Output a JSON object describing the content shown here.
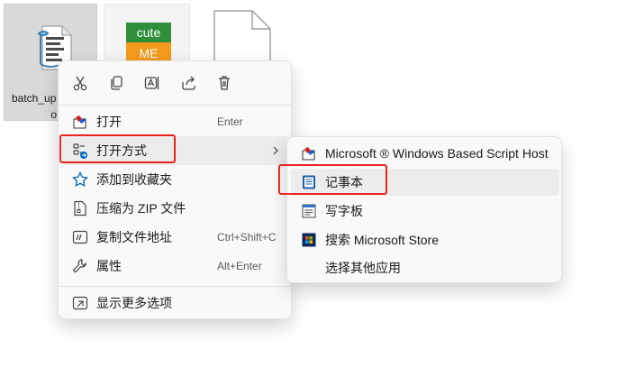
{
  "files": {
    "selected_file": {
      "name_line1": "batch_up",
      "name_line2": "o",
      "icon": "script-file-icon"
    },
    "second_file": {
      "icon_top": "cute",
      "icon_bottom": "ME"
    },
    "third_file": {
      "icon": "blank-document-icon"
    }
  },
  "context_menu": {
    "quick_actions": [
      {
        "name": "cut",
        "icon": "scissors-icon"
      },
      {
        "name": "copy",
        "icon": "copy-icon"
      },
      {
        "name": "rename",
        "icon": "rename-icon"
      },
      {
        "name": "share",
        "icon": "share-icon"
      },
      {
        "name": "delete",
        "icon": "trash-icon"
      }
    ],
    "items": [
      {
        "label": "打开",
        "shortcut": "Enter",
        "icon": "script-host-icon"
      },
      {
        "label": "打开方式",
        "shortcut": "",
        "icon": "open-with-icon",
        "has_submenu": true
      },
      {
        "label": "添加到收藏夹",
        "shortcut": "",
        "icon": "star-icon"
      },
      {
        "label": "压缩为 ZIP 文件",
        "shortcut": "",
        "icon": "zip-icon"
      },
      {
        "label": "复制文件地址",
        "shortcut": "Ctrl+Shift+C",
        "icon": "copy-path-icon"
      },
      {
        "label": "属性",
        "shortcut": "Alt+Enter",
        "icon": "wrench-icon"
      },
      {
        "label": "显示更多选项",
        "shortcut": "",
        "icon": "more-options-icon"
      }
    ]
  },
  "submenu": {
    "items": [
      {
        "label": "Microsoft ® Windows Based Script Host",
        "icon": "script-host-icon"
      },
      {
        "label": "记事本",
        "icon": "notepad-icon"
      },
      {
        "label": "写字板",
        "icon": "wordpad-icon"
      },
      {
        "label": "搜索 Microsoft Store",
        "icon": "store-icon"
      },
      {
        "label": "选择其他应用",
        "icon": ""
      }
    ]
  },
  "colors": {
    "highlight": "#e8251f",
    "accent": "#0067c0"
  }
}
